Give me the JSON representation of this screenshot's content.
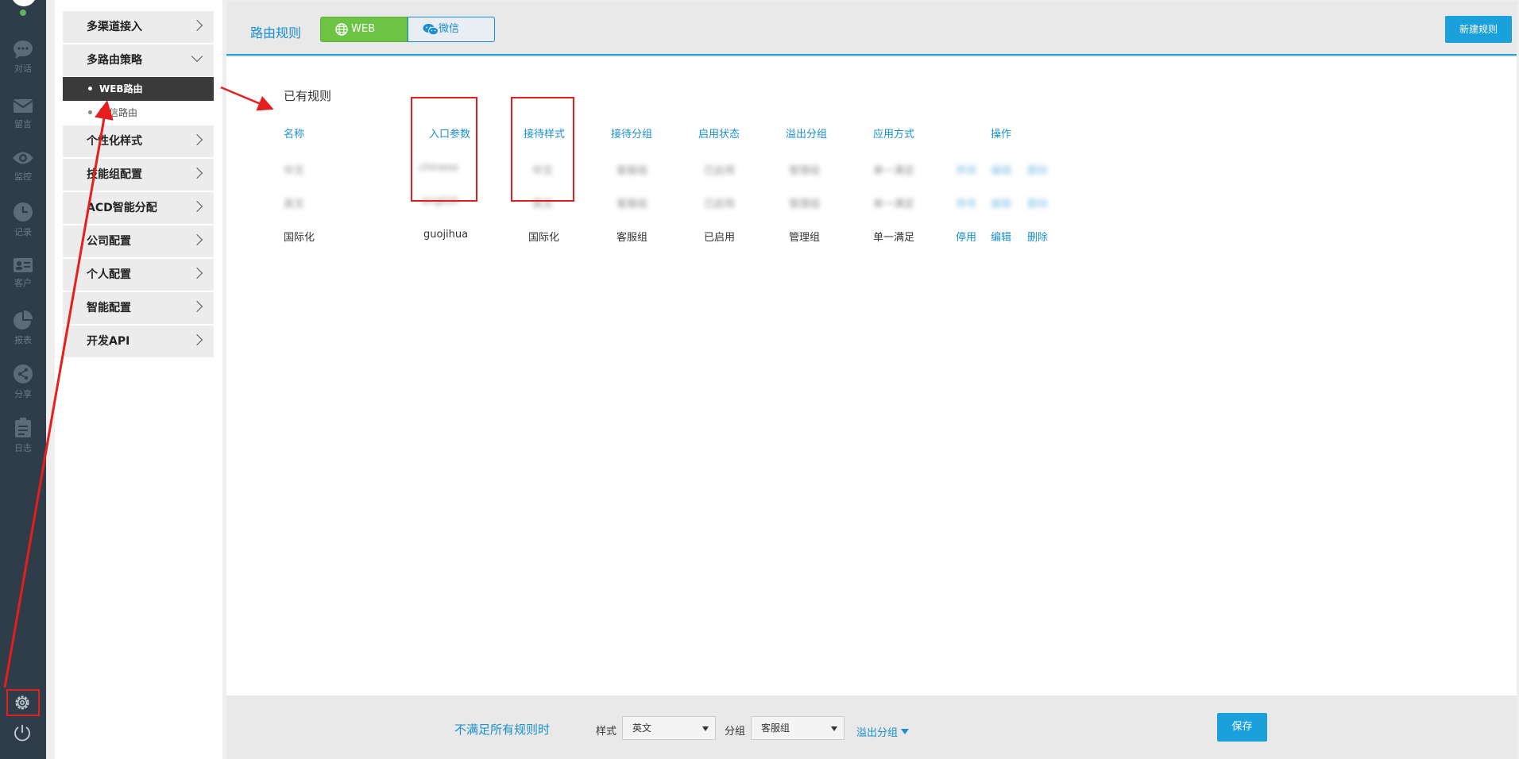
{
  "rail": {
    "items": [
      {
        "label": "对话",
        "icon": "chat-icon"
      },
      {
        "label": "留言",
        "icon": "mail-icon"
      },
      {
        "label": "监控",
        "icon": "eye-icon"
      },
      {
        "label": "记录",
        "icon": "clock-icon"
      },
      {
        "label": "客户",
        "icon": "contact-card-icon"
      },
      {
        "label": "报表",
        "icon": "pie-chart-icon"
      },
      {
        "label": "分享",
        "icon": "share-icon"
      },
      {
        "label": "日志",
        "icon": "clipboard-icon"
      }
    ]
  },
  "menu": {
    "items": [
      {
        "label": "多渠道接入"
      },
      {
        "label": "多路由策略"
      },
      {
        "label": "个性化样式"
      },
      {
        "label": "技能组配置"
      },
      {
        "label": "ACD智能分配"
      },
      {
        "label": "公司配置"
      },
      {
        "label": "个人配置"
      },
      {
        "label": "智能配置"
      },
      {
        "label": "开发API"
      }
    ],
    "subitems": [
      {
        "label": "WEB路由"
      },
      {
        "label": "微信路由"
      }
    ]
  },
  "header": {
    "title": "路由规则",
    "tab_web": "WEB",
    "tab_wechat": "微信",
    "new_rule": "新建规则"
  },
  "rules": {
    "section_title": "已有规则",
    "columns": [
      "名称",
      "入口参数",
      "接待样式",
      "接待分组",
      "启用状态",
      "溢出分组",
      "应用方式",
      "操作"
    ],
    "rows": [
      {
        "name": "中文",
        "entry": "chinese",
        "style": "中文",
        "group": "客服组",
        "status": "已启用",
        "overflow": "管理组",
        "mode": "单一满足",
        "ops": [
          "停用",
          "编辑",
          "删除"
        ]
      },
      {
        "name": "英文",
        "entry": "english",
        "style": "英文",
        "group": "客服组",
        "status": "已启用",
        "overflow": "管理组",
        "mode": "单一满足",
        "ops": [
          "停用",
          "编辑",
          "删除"
        ]
      },
      {
        "name": "国际化",
        "entry": "guojihua",
        "style": "国际化",
        "group": "客服组",
        "status": "已启用",
        "overflow": "管理组",
        "mode": "单一满足",
        "ops": [
          "停用",
          "编辑",
          "删除"
        ]
      }
    ]
  },
  "footer": {
    "fallback_label": "不满足所有规则时",
    "style_label": "样式",
    "style_value": "英文",
    "group_label": "分组",
    "group_value": "客服组",
    "overflow_link": "溢出分组",
    "save": "保存"
  },
  "colors": {
    "accent": "#1aa0da",
    "link": "#1a8fd0",
    "web_tab": "#6dc444",
    "rail": "#2e3d49",
    "annotation": "#e12020"
  }
}
